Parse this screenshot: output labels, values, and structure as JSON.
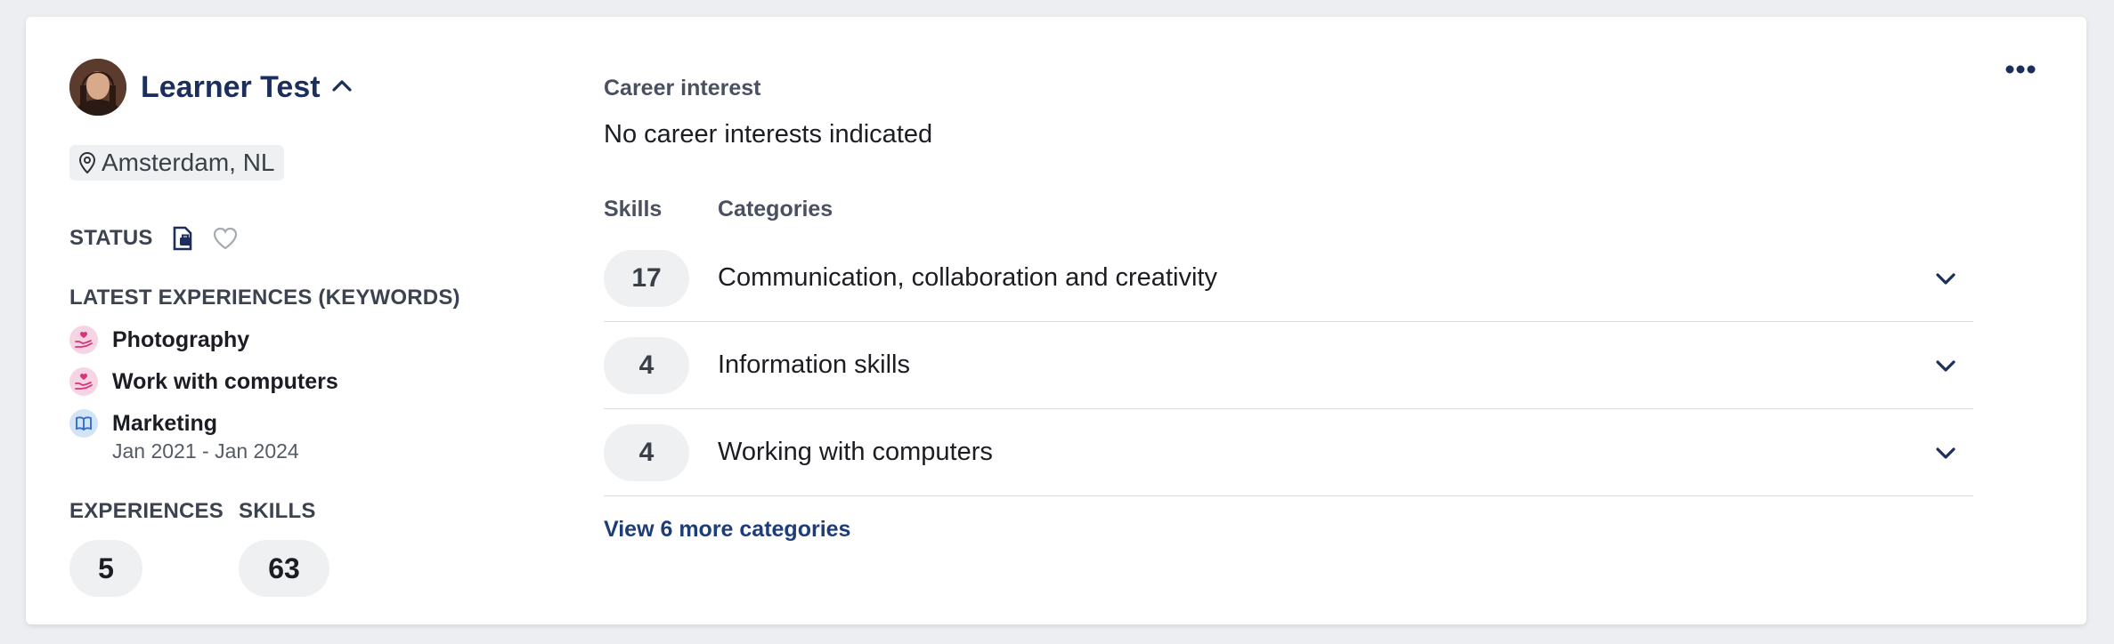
{
  "profile": {
    "name": "Learner Test",
    "location": "Amsterdam, NL"
  },
  "status": {
    "label": "STATUS"
  },
  "latest_experiences": {
    "title": "LATEST EXPERIENCES (KEYWORDS)",
    "items": [
      {
        "title": "Photography",
        "date": "",
        "icon": "hand-heart-icon",
        "color": "#d8347a"
      },
      {
        "title": "Work with computers",
        "date": "",
        "icon": "hand-heart-icon",
        "color": "#d8347a"
      },
      {
        "title": "Marketing",
        "date": "Jan 2021 - Jan 2024",
        "icon": "book-icon",
        "color": "#2f6fd1"
      }
    ]
  },
  "counts": {
    "experiences_label": "EXPERIENCES",
    "experiences_value": "5",
    "skills_label": "SKILLS",
    "skills_value": "63"
  },
  "career": {
    "label": "Career interest",
    "value": "No career interests indicated"
  },
  "skills_table": {
    "skills_header": "Skills",
    "categories_header": "Categories",
    "rows": [
      {
        "count": "17",
        "name": "Communication, collaboration and creativity"
      },
      {
        "count": "4",
        "name": "Information skills"
      },
      {
        "count": "4",
        "name": "Working with computers"
      }
    ],
    "view_more": "View 6 more categories"
  },
  "colors": {
    "primary": "#1c2f5c",
    "link": "#1c3d7a",
    "pill_bg": "#eef0f2"
  }
}
